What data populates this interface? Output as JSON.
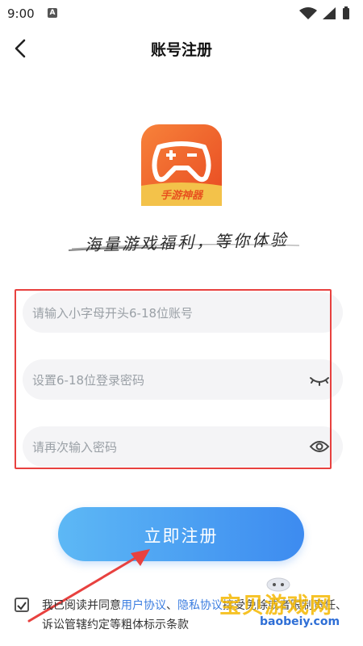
{
  "status_bar": {
    "time": "9:00",
    "notification_badge": "A"
  },
  "header": {
    "title": "账号注册",
    "back_icon": "chevron-left-icon"
  },
  "app": {
    "logo_text": "手游神器",
    "slogan": "海量游戏福利，等你体验"
  },
  "form": {
    "account_placeholder": "请输入小字母开头6-18位账号",
    "password_placeholder": "设置6-18位登录密码",
    "confirm_placeholder": "请再次输入密码"
  },
  "register_button": "立即注册",
  "agreement": {
    "prefix": "我已阅读并同意",
    "user_agreement": "用户协议",
    "separator": "、",
    "privacy_agreement": "隐私协议",
    "suffix": "接受免除或者限制责任、诉讼管辖约定等粗体标示条款"
  },
  "watermark": {
    "text": "宝贝游戏网",
    "url": "baobeiy.com"
  },
  "colors": {
    "accent": "#3d8bf0",
    "highlight_box": "#e8413f",
    "link": "#3b7de0",
    "logo_orange": "#f06a2a"
  }
}
